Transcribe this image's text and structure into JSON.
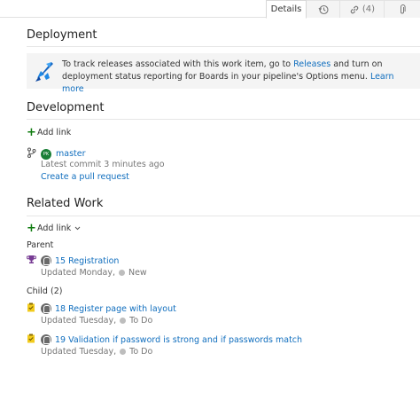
{
  "tabs": {
    "details": "Details",
    "history_icon": "history-icon",
    "links_count": "(4)",
    "links_icon": "link-icon",
    "attachment_icon": "paperclip-icon"
  },
  "deployment": {
    "title": "Deployment",
    "text_before": "To track releases associated with this work item, go to ",
    "releases_link": "Releases",
    "text_after": " and turn on deployment status reporting for Boards in your pipeline's Options menu. ",
    "learn_more": "Learn more"
  },
  "development": {
    "title": "Development",
    "add_link": "Add link",
    "branch": {
      "avatar_initials": "PK",
      "name": "master",
      "commit_info": "Latest commit 3 minutes ago",
      "create_pr": "Create a pull request"
    }
  },
  "related_work": {
    "title": "Related Work",
    "add_link": "Add link",
    "parent_label": "Parent",
    "parent": {
      "id": "15",
      "title": "Registration",
      "updated": "Updated Monday,",
      "state": "New",
      "type_icon": "trophy-icon"
    },
    "child_label": "Child (2)",
    "children": [
      {
        "id": "18",
        "title": "Register page with layout",
        "updated": "Updated Tuesday,",
        "state": "To Do",
        "type_icon": "task-icon"
      },
      {
        "id": "19",
        "title": "Validation if password is strong and if passwords match",
        "updated": "Updated Tuesday,",
        "state": "To Do",
        "type_icon": "task-icon"
      }
    ]
  },
  "colors": {
    "link": "#106ebe",
    "add_plus": "#107c10",
    "trophy": "#773b93",
    "task": "#f2cb1d",
    "state_dot": "#bdbdbd"
  }
}
